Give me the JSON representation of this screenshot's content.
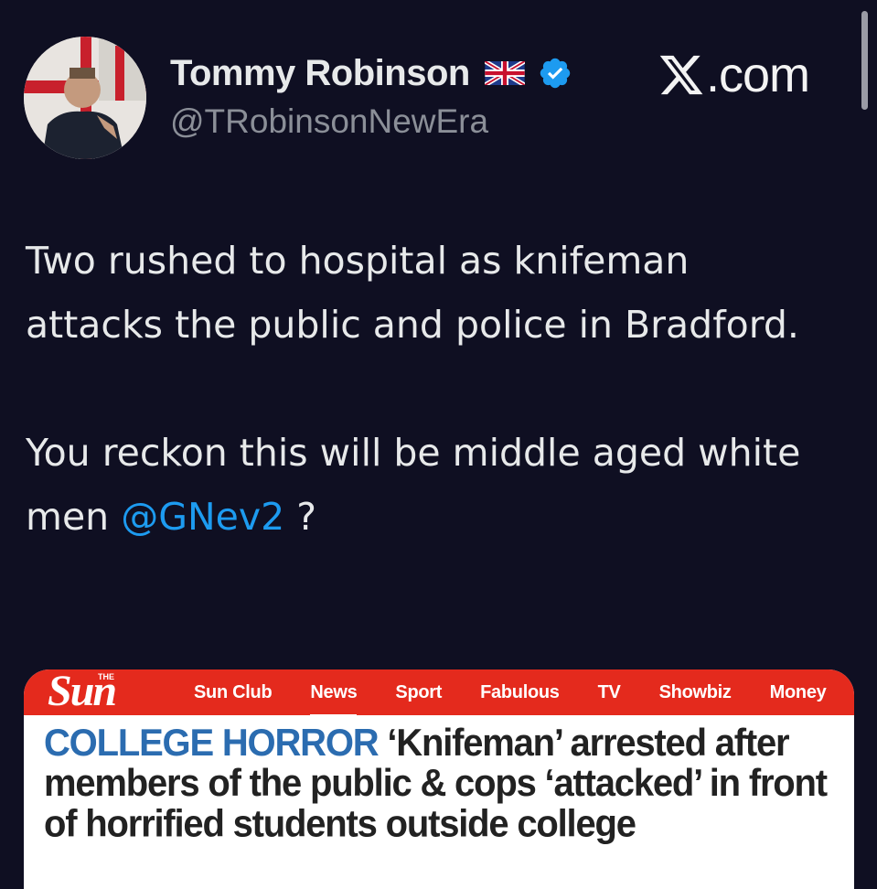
{
  "user": {
    "display_name": "Tommy Robinson",
    "handle": "@TRobinsonNewEra",
    "flag_icon": "uk-flag-icon",
    "verified_icon": "verified-badge-icon",
    "verified_color": "#1d9bf0"
  },
  "brand": {
    "logo_icon": "x-logo-icon",
    "suffix": ".com"
  },
  "tweet": {
    "paragraph1": "Two rushed to hospital as knifeman attacks the public and police in Bradford.",
    "paragraph2_prefix": "You reckon this will be middle aged white men",
    "mention": "@GNev2",
    "paragraph2_suffix": " ?"
  },
  "card": {
    "site_prefix": "THE",
    "site_name": "Sun",
    "brand_color": "#e42a1d",
    "nav": [
      {
        "label": "Sun Club",
        "active": false
      },
      {
        "label": "News",
        "active": true
      },
      {
        "label": "Sport",
        "active": false
      },
      {
        "label": "Fabulous",
        "active": false
      },
      {
        "label": "TV",
        "active": false
      },
      {
        "label": "Showbiz",
        "active": false
      },
      {
        "label": "Money",
        "active": false
      }
    ],
    "kicker": "COLLEGE HORROR",
    "headline": "‘Knifeman’ arrested after members of the public & cops ‘attacked’ in front of horrified students outside college"
  },
  "colors": {
    "background": "#0f0f22",
    "mention": "#1d9bf0",
    "kicker": "#2b6cb0"
  }
}
